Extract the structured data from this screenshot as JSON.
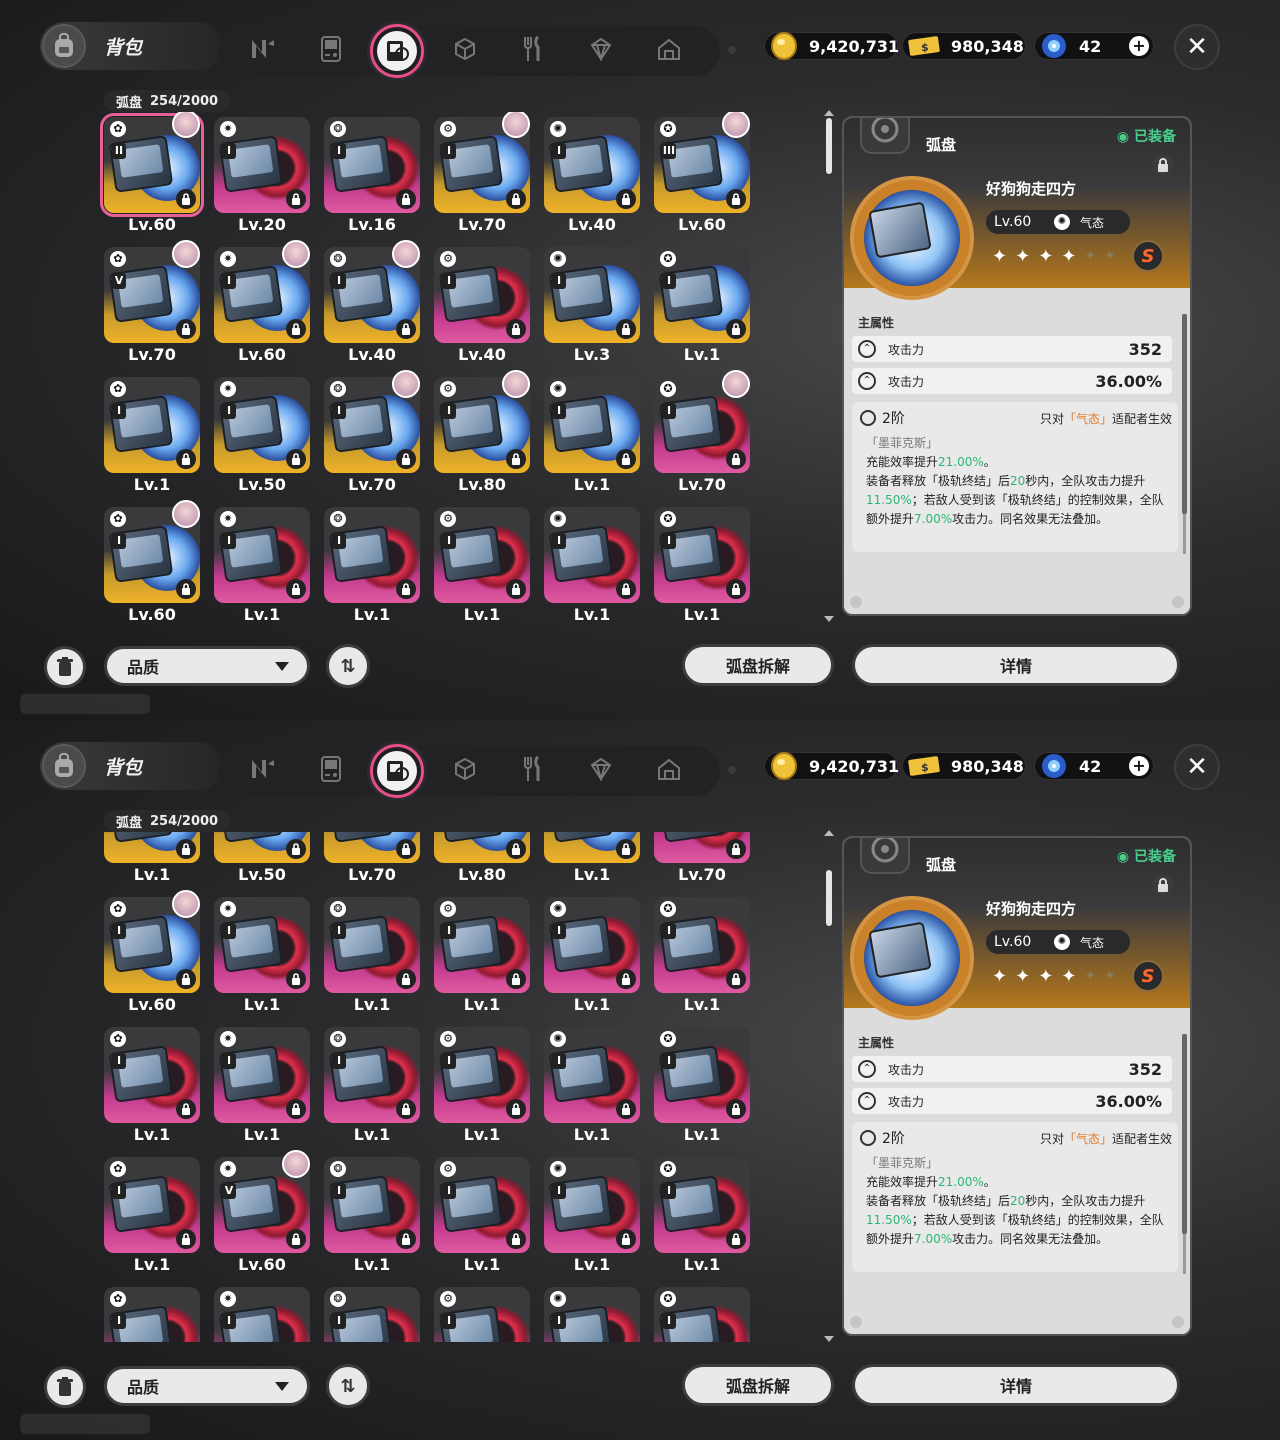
{
  "header": {
    "bag_label": "背包",
    "category_icons": [
      "n-logo-icon",
      "handheld-console-icon",
      "drive-disc-icon",
      "cube-icon",
      "fork-knife-icon",
      "diamond-box-icon",
      "home-icon"
    ],
    "active_category": "drive-disc-icon"
  },
  "currencies": [
    {
      "icon": "gold-coin-icon",
      "value": "9,420,731"
    },
    {
      "icon": "ticket-icon",
      "value": "980,348"
    },
    {
      "icon": "blue-crystal-icon",
      "value": "42"
    }
  ],
  "inventory": {
    "category": "弧盘",
    "count": "254/2000"
  },
  "screens": [
    {
      "items": [
        {
          "lv": "Lv.60",
          "q": "gold",
          "avatar": true,
          "rank": "II",
          "selected": true
        },
        {
          "lv": "Lv.20",
          "q": "pink",
          "avatar": false,
          "rank": "I"
        },
        {
          "lv": "Lv.16",
          "q": "pink",
          "avatar": false,
          "rank": "I"
        },
        {
          "lv": "Lv.70",
          "q": "gold",
          "avatar": true,
          "rank": "I"
        },
        {
          "lv": "Lv.40",
          "q": "gold",
          "avatar": false,
          "rank": "I"
        },
        {
          "lv": "Lv.60",
          "q": "gold",
          "avatar": true,
          "rank": "III"
        },
        {
          "lv": "Lv.70",
          "q": "gold",
          "avatar": true,
          "rank": "V"
        },
        {
          "lv": "Lv.60",
          "q": "gold",
          "avatar": true,
          "rank": "I"
        },
        {
          "lv": "Lv.40",
          "q": "gold",
          "avatar": true,
          "rank": "I"
        },
        {
          "lv": "Lv.40",
          "q": "pink",
          "avatar": false,
          "rank": "I"
        },
        {
          "lv": "Lv.3",
          "q": "gold",
          "avatar": false,
          "rank": "I"
        },
        {
          "lv": "Lv.1",
          "q": "gold",
          "avatar": false,
          "rank": "I"
        },
        {
          "lv": "Lv.1",
          "q": "gold",
          "avatar": false,
          "rank": "I"
        },
        {
          "lv": "Lv.50",
          "q": "gold",
          "avatar": false,
          "rank": "I"
        },
        {
          "lv": "Lv.70",
          "q": "gold",
          "avatar": true,
          "rank": "I"
        },
        {
          "lv": "Lv.80",
          "q": "gold",
          "avatar": true,
          "rank": "I"
        },
        {
          "lv": "Lv.1",
          "q": "gold",
          "avatar": false,
          "rank": "I"
        },
        {
          "lv": "Lv.70",
          "q": "pink",
          "avatar": true,
          "rank": "I"
        },
        {
          "lv": "Lv.60",
          "q": "gold",
          "avatar": true,
          "rank": "I"
        },
        {
          "lv": "Lv.1",
          "q": "pink",
          "avatar": false,
          "rank": "I"
        },
        {
          "lv": "Lv.1",
          "q": "pink",
          "avatar": false,
          "rank": "I"
        },
        {
          "lv": "Lv.1",
          "q": "pink",
          "avatar": false,
          "rank": "I"
        },
        {
          "lv": "Lv.1",
          "q": "pink",
          "avatar": false,
          "rank": "I"
        },
        {
          "lv": "Lv.1",
          "q": "pink",
          "avatar": false,
          "rank": "I"
        }
      ]
    },
    {
      "items": [
        {
          "lv": "Lv.1",
          "q": "gold",
          "avatar": false,
          "rank": ""
        },
        {
          "lv": "Lv.50",
          "q": "gold",
          "avatar": false,
          "rank": ""
        },
        {
          "lv": "Lv.70",
          "q": "gold",
          "avatar": false,
          "rank": ""
        },
        {
          "lv": "Lv.80",
          "q": "gold",
          "avatar": false,
          "rank": ""
        },
        {
          "lv": "Lv.1",
          "q": "gold",
          "avatar": false,
          "rank": ""
        },
        {
          "lv": "Lv.70",
          "q": "pink",
          "avatar": false,
          "rank": ""
        },
        {
          "lv": "Lv.60",
          "q": "gold",
          "avatar": true,
          "rank": "I"
        },
        {
          "lv": "Lv.1",
          "q": "pink",
          "avatar": false,
          "rank": "I"
        },
        {
          "lv": "Lv.1",
          "q": "pink",
          "avatar": false,
          "rank": "I"
        },
        {
          "lv": "Lv.1",
          "q": "pink",
          "avatar": false,
          "rank": "I"
        },
        {
          "lv": "Lv.1",
          "q": "pink",
          "avatar": false,
          "rank": "I"
        },
        {
          "lv": "Lv.1",
          "q": "pink",
          "avatar": false,
          "rank": "I"
        },
        {
          "lv": "Lv.1",
          "q": "pink",
          "avatar": false,
          "rank": "I"
        },
        {
          "lv": "Lv.1",
          "q": "pink",
          "avatar": false,
          "rank": "I"
        },
        {
          "lv": "Lv.1",
          "q": "pink",
          "avatar": false,
          "rank": "I"
        },
        {
          "lv": "Lv.1",
          "q": "pink",
          "avatar": false,
          "rank": "I"
        },
        {
          "lv": "Lv.1",
          "q": "pink",
          "avatar": false,
          "rank": "I"
        },
        {
          "lv": "Lv.1",
          "q": "pink",
          "avatar": false,
          "rank": "I"
        },
        {
          "lv": "Lv.1",
          "q": "pink",
          "avatar": false,
          "rank": "I"
        },
        {
          "lv": "Lv.60",
          "q": "pink",
          "avatar": true,
          "rank": "V"
        },
        {
          "lv": "Lv.1",
          "q": "pink",
          "avatar": false,
          "rank": "I"
        },
        {
          "lv": "Lv.1",
          "q": "pink",
          "avatar": false,
          "rank": "I"
        },
        {
          "lv": "Lv.1",
          "q": "pink",
          "avatar": false,
          "rank": "I"
        },
        {
          "lv": "Lv.1",
          "q": "pink",
          "avatar": false,
          "rank": "I"
        },
        {
          "lv": "",
          "q": "pink",
          "avatar": false,
          "rank": "I"
        },
        {
          "lv": "",
          "q": "pink",
          "avatar": false,
          "rank": "I"
        },
        {
          "lv": "",
          "q": "pink",
          "avatar": false,
          "rank": "I"
        },
        {
          "lv": "",
          "q": "pink",
          "avatar": false,
          "rank": "I"
        },
        {
          "lv": "",
          "q": "pink",
          "avatar": false,
          "rank": "I"
        },
        {
          "lv": "",
          "q": "pink",
          "avatar": false,
          "rank": "I"
        }
      ]
    }
  ],
  "detail": {
    "panel_title": "弧盘",
    "equipped": "已装备",
    "name": "好狗狗走四方",
    "level": "Lv.60",
    "attribute": "气态",
    "rank_badge": "S",
    "stars_filled": 4,
    "stars_total": 6,
    "main_attr_label": "主属性",
    "stats": [
      {
        "name": "攻击力",
        "value": "352"
      },
      {
        "name": "攻击力",
        "value": "36.00%"
      }
    ],
    "set_tier": "2阶",
    "set_cond_pre": "只对",
    "set_cond_hl": "「气态」",
    "set_cond_post": "适配者生效",
    "set_name": "「墨菲克斯」",
    "set_line1_pre": "充能效率提升",
    "set_line1_val": "21.00%",
    "set_line1_post": "。",
    "set_line2_pre": "装备者释放「极轨终结」后",
    "set_line2_val": "20",
    "set_line2_mid": "秒内，全队攻击力提升",
    "set_line2_val2": "11.50%",
    "set_line2_post": "；若敌人受到该「极轨终结」的控制效果，全队额外提升",
    "set_line2_val3": "7.00%",
    "set_line2_end": "攻击力。同名效果无法叠加。"
  },
  "footer": {
    "quality_label": "品质",
    "dismantle_label": "弧盘拆解",
    "details_label": "详情"
  },
  "colors": {
    "accent_pink": "#e84d8a",
    "gold_quality": "#f0b22a",
    "pink_quality": "#e05aa0",
    "equipped_green": "#49d18b",
    "highlight_orange": "#e17a2d",
    "value_green": "#29b873"
  }
}
